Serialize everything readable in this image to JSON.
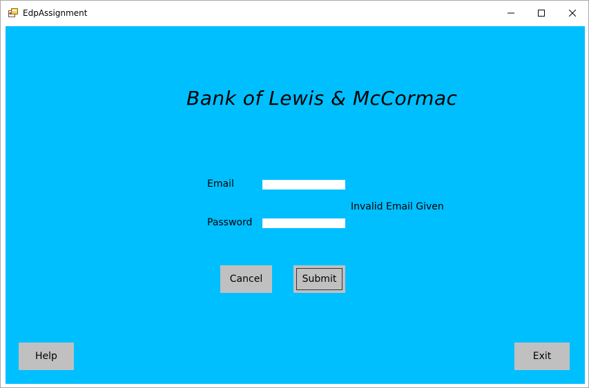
{
  "window": {
    "title": "EdpAssignment",
    "app_icon": "winforms-app-icon",
    "controls": {
      "minimize": "minimize-icon",
      "maximize": "maximize-icon",
      "close": "close-icon"
    }
  },
  "form": {
    "bank_title": "Bank of Lewis & McCormac",
    "email_label": "Email",
    "email_value": "",
    "password_label": "Password",
    "password_value": "",
    "error_message": "Invalid Email Given",
    "cancel_label": "Cancel",
    "submit_label": "Submit",
    "help_label": "Help",
    "exit_label": "Exit"
  },
  "colors": {
    "background": "#00bfff",
    "button": "#c0c0c0",
    "field": "#ffffff"
  }
}
